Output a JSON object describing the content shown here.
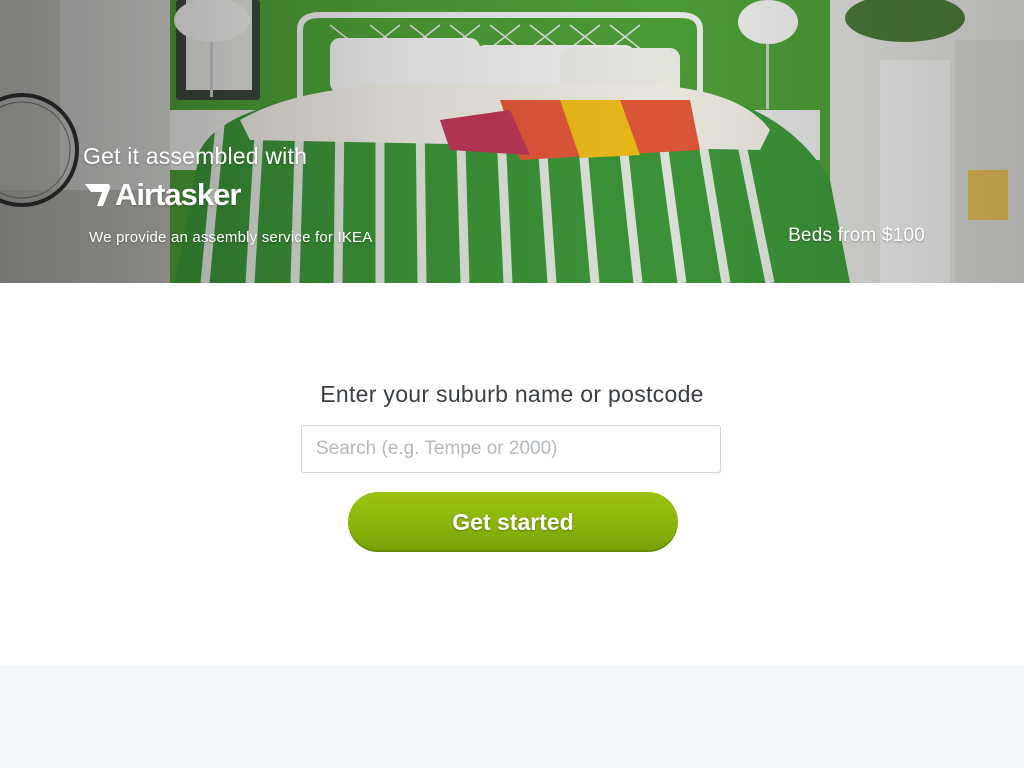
{
  "hero": {
    "tagline": "Get it assembled with",
    "brand": "Airtasker",
    "subtitle": "We provide an assembly service for IKEA",
    "price_note": "Beds from $100"
  },
  "search": {
    "heading": "Enter your suburb name or postcode",
    "placeholder": "Search (e.g. Tempe or 2000)",
    "value": "",
    "button_label": "Get started"
  },
  "colors": {
    "cta_green": "#8ab80c",
    "hero_wall_green": "#54a33c",
    "heading_text": "#3a3f45",
    "footer_band": "#f4f7fa"
  },
  "icons": [
    "airtasker-logo-icon"
  ]
}
